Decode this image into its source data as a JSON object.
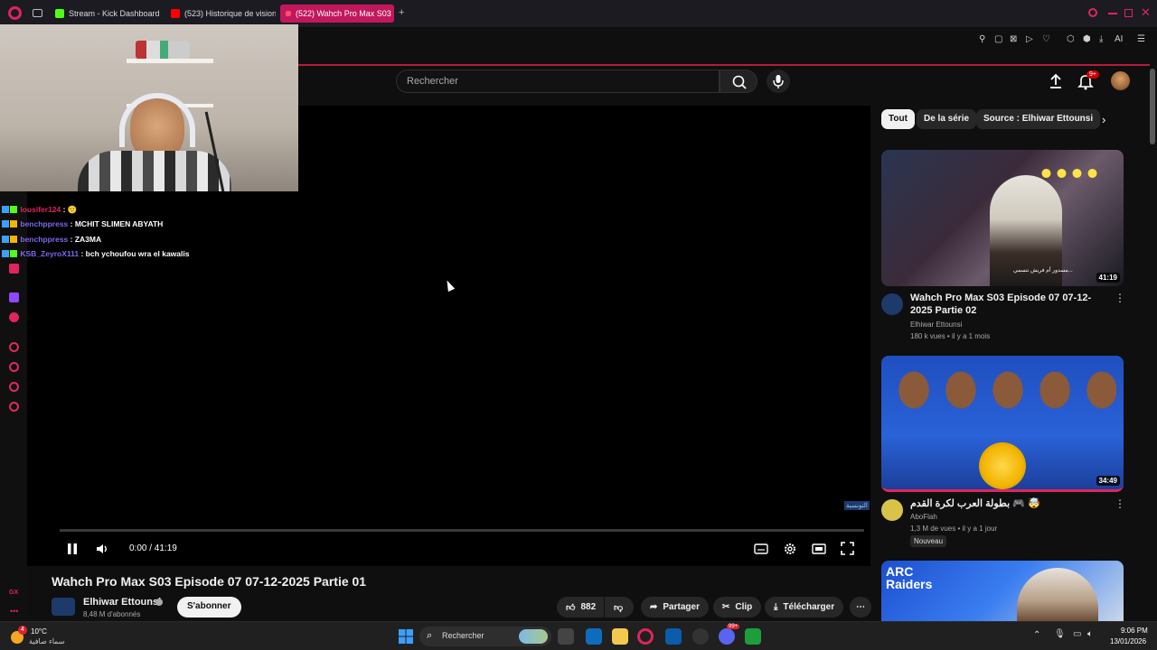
{
  "browser": {
    "tabs": [
      {
        "label": "Stream - Kick Dashboard",
        "color": "#53fc18"
      },
      {
        "label": "(523) Historique de vision",
        "color": "#ff0000"
      },
      {
        "label": "(522) Wahch Pro Max S03",
        "color": "#ff0000"
      }
    ],
    "new_tab": "+",
    "ai_label": "AI"
  },
  "youtube": {
    "search_placeholder": "Rechercher",
    "notif_badge": "9+",
    "player": {
      "time": "0:00 / 41:19",
      "watermark": "التونسية"
    },
    "video": {
      "title": "Wahch Pro Max S03 Episode 07 07-12-2025 Partie 01",
      "channel": "Elhiwar Ettounsi",
      "subscribers": "8,48 M d'abonnés",
      "subscribe_label": "S'abonner",
      "likes": "882",
      "share_label": "Partager",
      "clip_label": "Clip",
      "download_label": "Télécharger"
    },
    "chips": [
      "Tout",
      "De la série",
      "Source : Elhiwar Ettounsi"
    ],
    "recommendations": [
      {
        "title": "Wahch Pro Max S03 Episode 07 07-12-2025 Partie 02",
        "channel": "Elhiwar Ettounsi",
        "views": "180 k vues",
        "age": "il y a 1 mois",
        "duration": "41:19",
        "caption": "مسدور أم فريش نتسمي..."
      },
      {
        "title": "بطولة العرب لكرة القدم 🎮 🤯",
        "channel": "AboFlah",
        "views": "1,3 M de vues",
        "age": "il y a 1 jour",
        "duration": "34:49",
        "badge": "Nouveau"
      },
      {
        "thumb_text": "ARC Raiders"
      }
    ]
  },
  "chat": [
    {
      "user": "lousifer124",
      "user_color": "#e0245e",
      "message": "🙂"
    },
    {
      "user": "benchppress",
      "user_color": "#7b68ee",
      "message": "MCHIT SLIMEN ABYATH"
    },
    {
      "user": "benchppress",
      "user_color": "#7b68ee",
      "message": "ZA3MA"
    },
    {
      "user": "KSB_ZeyroX111",
      "user_color": "#7b68ee",
      "message": "bch ychoufou wra el kawalis"
    }
  ],
  "taskbar": {
    "weather_badge": "4",
    "temp": "10°C",
    "condition": "سماء صافية",
    "search": "Rechercher",
    "time": "9:06 PM",
    "date": "13/01/2026",
    "discord_badge": "99+"
  }
}
